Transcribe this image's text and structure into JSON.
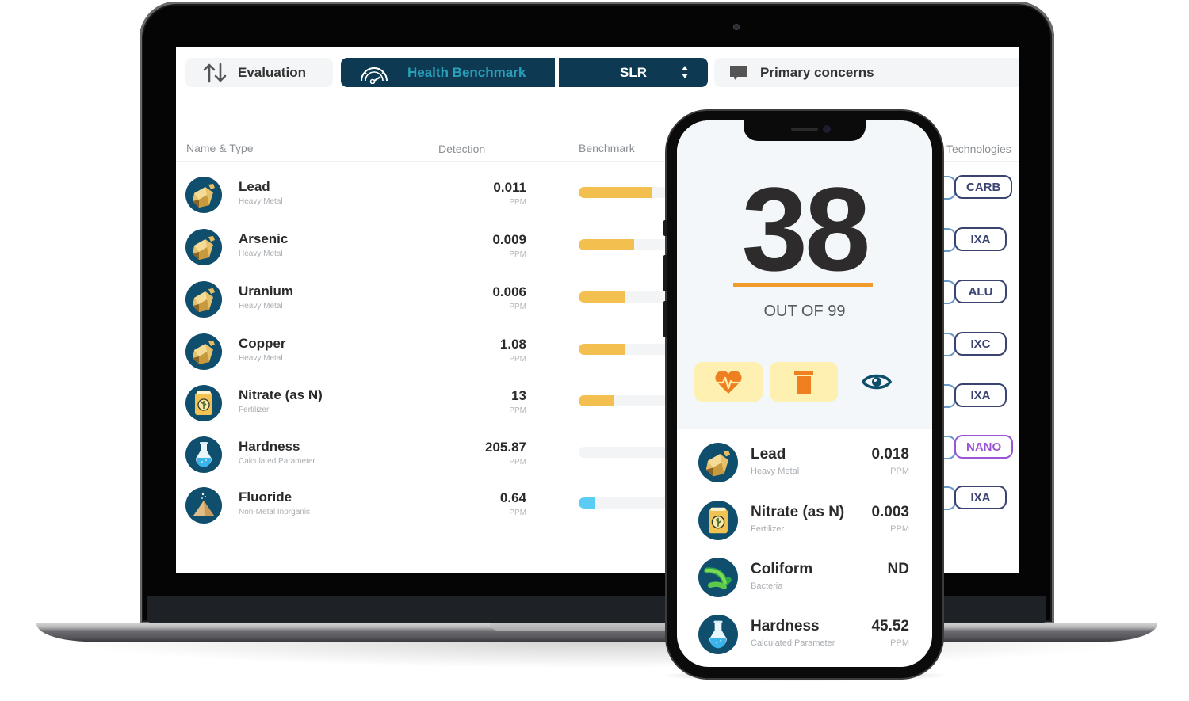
{
  "desktop": {
    "tabs": {
      "evaluation": {
        "label": "Evaluation",
        "icon": "sort-arrows-icon"
      },
      "health_benchmark": {
        "label": "Health Benchmark",
        "icon": "gauge-icon"
      },
      "standard": {
        "label": "SLR",
        "icon": "select-arrows-icon"
      },
      "primary_concerns": {
        "label": "Primary concerns",
        "icon": "speech-bubble-icon"
      }
    },
    "columns": {
      "name_type": "Name & Type",
      "detection": "Detection",
      "benchmark": "Benchmark",
      "technologies": "Technologies"
    },
    "rows": [
      {
        "name": "Lead",
        "type": "Heavy Metal",
        "detection": "0.011",
        "unit": "PPM",
        "benchmark_fill": 0.74,
        "benchmark_color": "#f3bf4f",
        "icon": "rock-icon",
        "technology": "CARB",
        "technology_color": "#3b4370"
      },
      {
        "name": "Arsenic",
        "type": "Heavy Metal",
        "detection": "0.009",
        "unit": "PPM",
        "benchmark_fill": 0.56,
        "benchmark_color": "#f3bf4f",
        "icon": "rock-icon",
        "technology": "IXA",
        "technology_color": "#3b4370"
      },
      {
        "name": "Uranium",
        "type": "Heavy Metal",
        "detection": "0.006",
        "unit": "PPM",
        "benchmark_fill": 0.47,
        "benchmark_color": "#f3bf4f",
        "icon": "rock-icon",
        "technology": "ALU",
        "technology_color": "#3b4370"
      },
      {
        "name": "Copper",
        "type": "Heavy Metal",
        "detection": "1.08",
        "unit": "PPM",
        "benchmark_fill": 0.47,
        "benchmark_color": "#f3bf4f",
        "icon": "rock-icon",
        "technology": "IXC",
        "technology_color": "#3b4370"
      },
      {
        "name": "Nitrate (as N)",
        "type": "Fertilizer",
        "detection": "13",
        "unit": "PPM",
        "benchmark_fill": 0.35,
        "benchmark_color": "#f3bf4f",
        "icon": "fertilizer-bag-icon",
        "technology": "IXA",
        "technology_color": "#3b4370"
      },
      {
        "name": "Hardness",
        "type": "Calculated Parameter",
        "detection": "205.87",
        "unit": "PPM",
        "benchmark_fill": 0,
        "benchmark_color": "#f3bf4f",
        "icon": "flask-icon",
        "technology": "NANO",
        "technology_color": "#9a55d6"
      },
      {
        "name": "Fluoride",
        "type": "Non-Metal Inorganic",
        "detection": "0.64",
        "unit": "PPM",
        "benchmark_fill": 0.17,
        "benchmark_color": "#5bcdf5",
        "icon": "sand-pile-icon",
        "technology": "IXA",
        "technology_color": "#3b4370"
      }
    ]
  },
  "mobile": {
    "score": "38",
    "score_subtitle": "OUT OF 99",
    "accent": "#ef9a2a",
    "actions": [
      {
        "name": "health",
        "icon": "heart-pulse-icon",
        "active": true
      },
      {
        "name": "filter",
        "icon": "filter-cartridge-icon",
        "active": true
      },
      {
        "name": "view",
        "icon": "eye-icon",
        "active": false
      }
    ],
    "rows": [
      {
        "name": "Lead",
        "type": "Heavy Metal",
        "detection": "0.018",
        "unit": "PPM",
        "icon": "rock-icon"
      },
      {
        "name": "Nitrate (as N)",
        "type": "Fertilizer",
        "detection": "0.003",
        "unit": "PPM",
        "icon": "fertilizer-bag-icon"
      },
      {
        "name": "Coliform",
        "type": "Bacteria",
        "detection": "ND",
        "unit": "",
        "icon": "bacteria-icon"
      },
      {
        "name": "Hardness",
        "type": "Calculated Parameter",
        "detection": "45.52",
        "unit": "PPM",
        "icon": "flask-icon"
      }
    ]
  }
}
